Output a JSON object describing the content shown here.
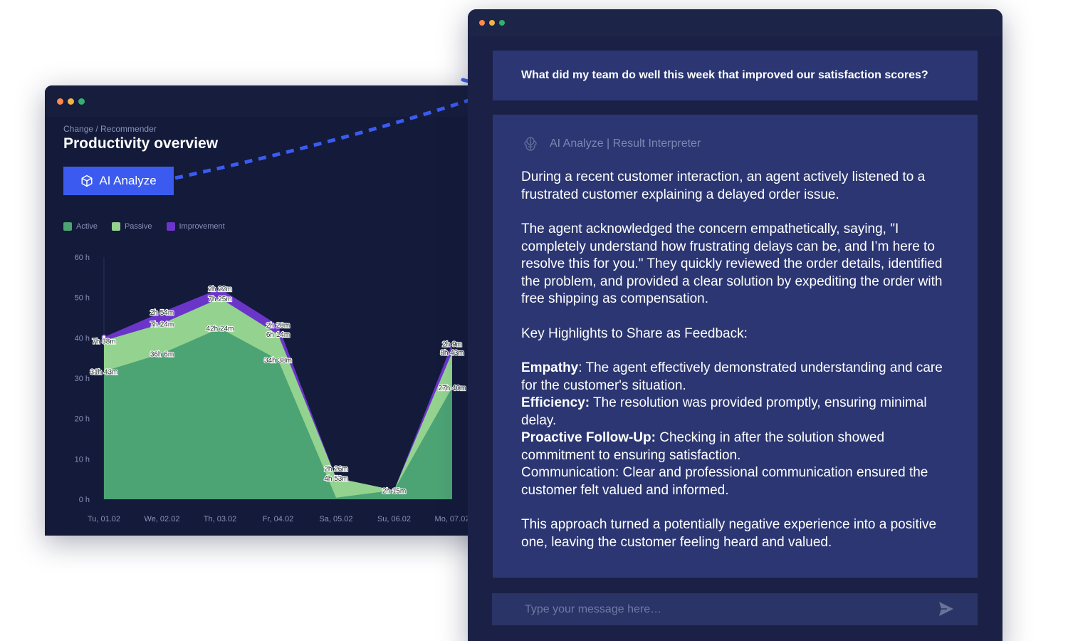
{
  "dashboard": {
    "breadcrumb": "Change / Recommender",
    "title": "Productivity overview",
    "ai_button_label": "AI Analyze",
    "legend": [
      {
        "label": "Active",
        "color": "#4ca374"
      },
      {
        "label": "Passive",
        "color": "#93d38f"
      },
      {
        "label": "Improvement",
        "color": "#6b35c9"
      }
    ]
  },
  "chart_data": {
    "type": "area",
    "stacked": true,
    "categories": [
      "Tu, 01.02",
      "We, 02.02",
      "Th, 03.02",
      "Fr, 04.02",
      "Sa, 05.02",
      "Su, 06.02",
      "Mo, 07.02"
    ],
    "yticks": [
      "0 h",
      "10 h",
      "20 h",
      "30 h",
      "40 h",
      "50 h",
      "60 h"
    ],
    "ylim": [
      0,
      60
    ],
    "series": [
      {
        "name": "Active",
        "color": "#4ca374",
        "values": [
          31.7,
          36.1,
          42.4,
          34.6,
          0.4,
          2.25,
          27.7
        ]
      },
      {
        "name": "Passive",
        "color": "#93d38f",
        "values": [
          7.6,
          7.4,
          7.42,
          6.23,
          4.9,
          0.0,
          8.7
        ]
      },
      {
        "name": "Improvement",
        "color": "#6b35c9",
        "values": [
          0.9,
          2.9,
          2.37,
          2.33,
          0.0,
          0.0,
          2.15
        ]
      }
    ],
    "data_labels": [
      {
        "text": "31h 43m",
        "ci": 0,
        "level": 31.7
      },
      {
        "text": "7h 38m",
        "ci": 0,
        "level": 39.3
      },
      {
        "text": "36h 6m",
        "ci": 1,
        "level": 36.1
      },
      {
        "text": "7h 24m",
        "ci": 1,
        "level": 43.5
      },
      {
        "text": "2h 54m",
        "ci": 1,
        "level": 46.4
      },
      {
        "text": "42h 24m",
        "ci": 2,
        "level": 42.4
      },
      {
        "text": "7h 25m",
        "ci": 2,
        "level": 49.8
      },
      {
        "text": "2h 22m",
        "ci": 2,
        "level": 52.2
      },
      {
        "text": "34h 38m",
        "ci": 3,
        "level": 34.6
      },
      {
        "text": "6h 14m",
        "ci": 3,
        "level": 40.9
      },
      {
        "text": "2h 20m",
        "ci": 3,
        "level": 43.2
      },
      {
        "text": "4h 53m",
        "ci": 4,
        "level": 5.3
      },
      {
        "text": "2h 26m",
        "ci": 4,
        "level": 7.7
      },
      {
        "text": "2h 15m",
        "ci": 5,
        "level": 2.2
      },
      {
        "text": "27h 40m",
        "ci": 6,
        "level": 27.7
      },
      {
        "text": "8h 43m",
        "ci": 6,
        "level": 36.4
      },
      {
        "text": "2h 9m",
        "ci": 6,
        "level": 38.6
      }
    ],
    "grid": false
  },
  "chat": {
    "question": "What did my team do well this week that improved our satisfaction scores?",
    "assistant_label": "AI Analyze | Result Interpreter",
    "paragraph1": "During a recent customer interaction, an agent actively listened to a frustrated customer explaining a delayed order issue.",
    "paragraph2": "The agent acknowledged the concern empathetically, saying, \"I completely understand how frustrating delays can be, and I’m here to resolve this for you.\" They quickly reviewed the order details, identified the problem, and provided a clear solution by expediting the order with free shipping as compensation.",
    "paragraph3": "Key Highlights to Share as Feedback:",
    "highlights": [
      {
        "label": "Empathy",
        "text": ": The agent effectively demonstrated understanding and care for the customer's situation."
      },
      {
        "label": "Efficiency:",
        "text": " The resolution was provided promptly, ensuring minimal delay."
      },
      {
        "label": "Proactive Follow-Up:",
        "text": " Checking in after the solution showed commitment to ensuring satisfaction."
      }
    ],
    "communication": "Communication: Clear and professional communication ensured the customer felt valued and informed.",
    "paragraph4": "This approach turned a potentially negative experience into a positive one, leaving the customer feeling heard and valued.",
    "input_placeholder": "Type your message here…"
  },
  "icons": {
    "ai_button": "cube-icon",
    "assistant": "brain-icon",
    "send": "send-icon"
  },
  "colors": {
    "accent_blue": "#3b5bf0",
    "connector": "#3b5bf0"
  }
}
